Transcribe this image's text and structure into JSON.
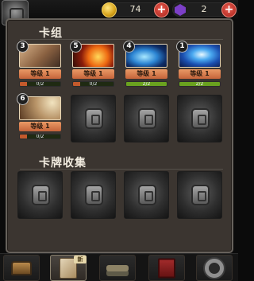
{
  "currency": {
    "gold": {
      "icon": "gold-coin-icon",
      "value": "74",
      "add_icon": "plus-icon"
    },
    "gems": {
      "icon": "purple-gem-icon",
      "value": "2",
      "add_icon": "plus-icon"
    }
  },
  "deck": {
    "title": "卡组",
    "cards": [
      {
        "cost": "3",
        "art": "boot-kick-art",
        "level_label": "等级 1",
        "progress_text": "0/2",
        "progress": 0.0,
        "progress_color": "#c35a2c"
      },
      {
        "cost": "5",
        "art": "fireball-art",
        "level_label": "等级 1",
        "progress_text": "0/2",
        "progress": 0.0,
        "progress_color": "#c35a2c"
      },
      {
        "cost": "4",
        "art": "ice-bolt-art",
        "level_label": "等级 1",
        "progress_text": "2/2",
        "progress": 1.0,
        "progress_color": "#6aa21f"
      },
      {
        "cost": "1",
        "art": "lightning-art",
        "level_label": "等级 1",
        "progress_text": "2/2",
        "progress": 1.0,
        "progress_color": "#6aa21f"
      },
      {
        "cost": "6",
        "art": "arrow-volley-art",
        "level_label": "等级 1",
        "progress_text": "0/2",
        "progress": 0.0,
        "progress_color": "#c35a2c"
      }
    ],
    "locked_slot_icon": "locked-slot-icon"
  },
  "collection": {
    "title": "卡牌收集",
    "locked_slot_icon": "locked-slot-icon"
  },
  "nav": {
    "items": [
      {
        "icon": "chest-icon"
      },
      {
        "icon": "cards-icon",
        "badge": "新"
      },
      {
        "icon": "crossed-swords-icon"
      },
      {
        "icon": "book-icon"
      },
      {
        "icon": "settings-gear-icon"
      }
    ]
  }
}
